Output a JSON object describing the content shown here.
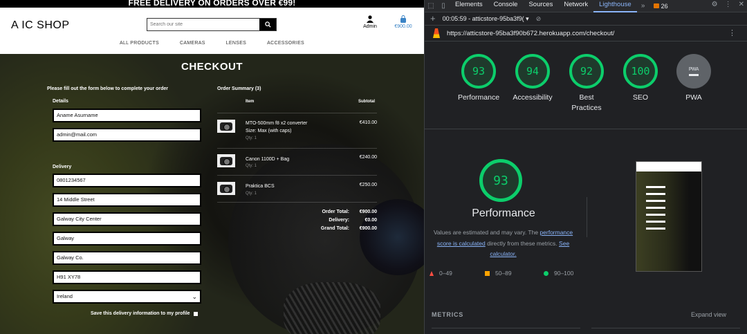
{
  "shop": {
    "banner": "FREE DELIVERY ON ORDERS OVER €99!",
    "logo_text": "A IC SHOP",
    "search_placeholder": "Search our site",
    "account_label": "Admin",
    "bag_total": "€900.00",
    "nav": [
      "ALL PRODUCTS",
      "CAMERAS",
      "LENSES",
      "ACCESSORIES"
    ],
    "page_title": "CHECKOUT",
    "form_note": "Please fill out the form below to complete your order",
    "details_label": "Details",
    "details": {
      "full_name": "Aname Asurname",
      "email": "admin@mail.com"
    },
    "delivery_label": "Delivery",
    "delivery": {
      "phone": "0801234567",
      "street1": "14 Middle Street",
      "street2": "Galway City Center",
      "town": "Galway",
      "county": "Galway Co.",
      "postcode": "H91 XY78",
      "country": "Ireland"
    },
    "save_info_label": "Save this delivery information to my profile",
    "order_summary": {
      "title": "Order Summary (3)",
      "col_item": "Item",
      "col_subtotal": "Subtotal",
      "items": [
        {
          "name": "MTO-500mm f8 x2 converter",
          "size": "Size: Max (with caps)",
          "qty": "Qty: 1",
          "price": "€410.00"
        },
        {
          "name": "Canon 1100D + Bag",
          "qty": "Qty: 1",
          "price": "€240.00"
        },
        {
          "name": "Praktica BCS",
          "qty": "Qty: 1",
          "price": "€250.00"
        }
      ],
      "order_total_label": "Order Total:",
      "order_total": "€900.00",
      "delivery_label": "Delivery:",
      "delivery": "€0.00",
      "grand_total_label": "Grand Total:",
      "grand_total": "€900.00"
    }
  },
  "devtools": {
    "tabs": [
      "Elements",
      "Console",
      "Sources",
      "Network",
      "Lighthouse"
    ],
    "active_tab": "Lighthouse",
    "more": "»",
    "issues_count": "26",
    "report_selector": "00:05:59 - atticstore-95ba3f9(",
    "url": "https://atticstore-95ba3f90b672.herokuapp.com/checkout/",
    "scores": [
      {
        "label": "Performance",
        "score": "93"
      },
      {
        "label": "Accessibility",
        "score": "94"
      },
      {
        "label": "Best Practices",
        "score": "92"
      },
      {
        "label": "SEO",
        "score": "100"
      }
    ],
    "pwa_label": "PWA",
    "pwa_badge": "PWA",
    "perf_score": "93",
    "perf_title": "Performance",
    "perf_desc_1": "Values are estimated and may vary. The",
    "perf_link_1": "performance score is calculated",
    "perf_desc_2": "directly from these metrics.",
    "perf_link_2": "See calculator.",
    "legend": [
      {
        "range": "0–49"
      },
      {
        "range": "50–89"
      },
      {
        "range": "90–100"
      }
    ],
    "metrics_label": "METRICS",
    "expand_view": "Expand view",
    "colors": {
      "pass": "#0cce6b",
      "average": "#ffa400",
      "fail": "#ff4e42",
      "link": "#8ab4f8"
    }
  }
}
